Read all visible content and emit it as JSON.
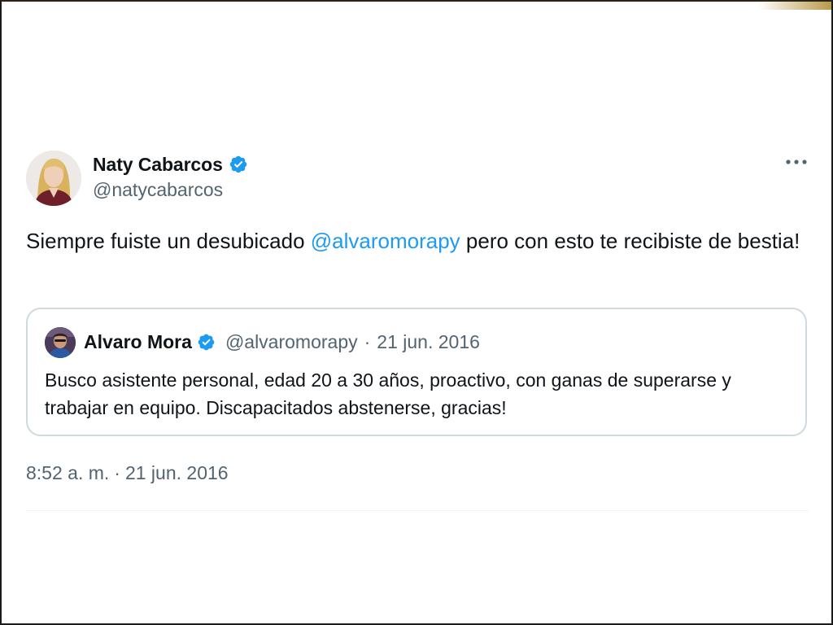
{
  "tweet": {
    "author": {
      "display_name": "Naty Cabarcos",
      "handle": "@natycabarcos"
    },
    "text_before": "Siempre fuiste un desubicado ",
    "mention": "@alvaromorapy",
    "text_after": " pero con esto te recibiste de bestia!",
    "timestamp": {
      "time": "8:52 a. m.",
      "separator": "·",
      "date": "21 jun. 2016"
    }
  },
  "quoted_tweet": {
    "display_name": "Alvaro Mora",
    "handle": "@alvaromorapy",
    "separator": "·",
    "date": "21 jun. 2016",
    "text": "Busco asistente personal, edad 20 a 30 años, proactivo, con ganas de superarse y trabajar en equipo. Discapacitados abstenerse, gracias!"
  },
  "icons": {
    "verified": "verified-badge-icon",
    "more": "more-options-icon"
  },
  "colors": {
    "link": "#1d9bf0",
    "text": "#0f1419",
    "secondary": "#536471",
    "border": "#cfd9de"
  }
}
